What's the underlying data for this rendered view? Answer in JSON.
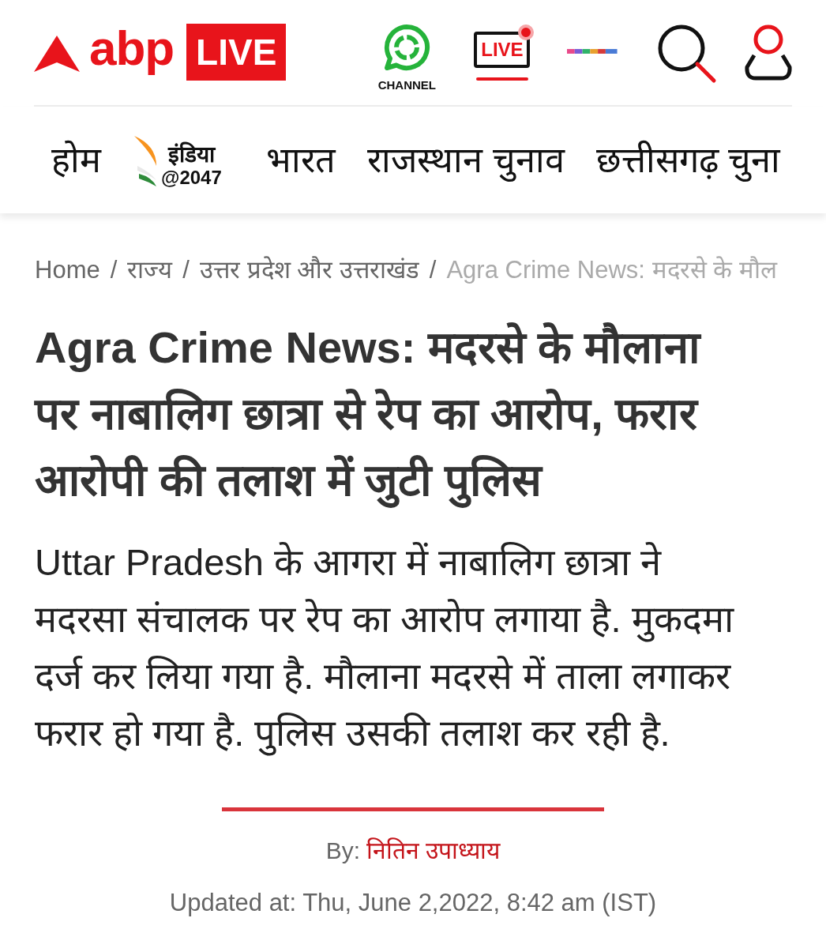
{
  "header": {
    "logo": {
      "brand": "abp",
      "badge": "LIVE"
    },
    "channel": {
      "label": "CHANNEL"
    },
    "live_tv": {
      "label": "LIVE"
    }
  },
  "nav": {
    "items": [
      {
        "kind": "text",
        "label": "होम"
      },
      {
        "kind": "logo",
        "title": "इंडिया",
        "subtitle": "@2047"
      },
      {
        "kind": "text",
        "label": "भारत"
      },
      {
        "kind": "text",
        "label": "राजस्थान चुनाव"
      },
      {
        "kind": "text",
        "label": "छत्तीसगढ़ चुना"
      }
    ]
  },
  "breadcrumb": {
    "separator": "/",
    "items": [
      {
        "label": "Home",
        "current": false
      },
      {
        "label": "राज्य",
        "current": false
      },
      {
        "label": "उत्तर प्रदेश और उत्तराखंड",
        "current": false
      },
      {
        "label": "Agra Crime News: मदरसे के मौल",
        "current": true
      }
    ]
  },
  "article": {
    "headline": "Agra Crime News: मदरसे के मौलाना पर नाबालिग छात्रा से रेप का आरोप, फरार आरोपी की तलाश में जुटी पुलिस",
    "summary": "Uttar Pradesh के आगरा में नाबालिग छात्रा ने मदरसा संचालक पर रेप का आरोप लगाया है. मुकदमा दर्ज कर लिया गया है. मौलाना मदरसे में ताला लगाकर फरार हो गया है. पुलिस उसकी तलाश कर रही है.",
    "byline": {
      "prefix": "By:",
      "author": "नितिन उपाध्याय"
    },
    "updated": "Updated at: Thu, June 2,2022, 8:42 am (IST)"
  }
}
